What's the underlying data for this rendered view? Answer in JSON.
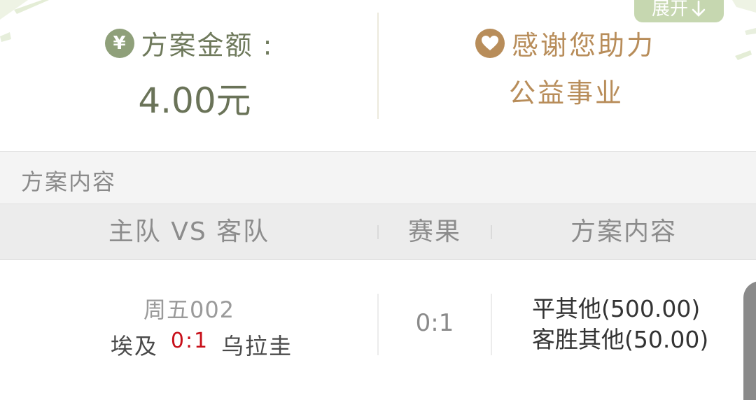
{
  "header": {
    "expand_label": "展开",
    "amount_label": "方案金额 :",
    "amount_value": "4.00元",
    "thanks_line1": "感谢您助力",
    "thanks_line2": "公益事业",
    "yen_symbol": "¥"
  },
  "section": {
    "title": "方案内容"
  },
  "table": {
    "columns": [
      "主队 VS 客队",
      "赛果",
      "方案内容"
    ],
    "rows": [
      {
        "match_no": "周五002",
        "home": "埃及",
        "score": "0:1",
        "away": "乌拉圭",
        "result": "0:1",
        "plan": [
          "平其他(500.00)",
          "客胜其他(50.00)"
        ]
      }
    ]
  },
  "colors": {
    "amount_green": "#6a7358",
    "thanks_gold": "#b88d5a",
    "score_red": "#c8101a",
    "expand_bg": "#c6d7b0"
  }
}
